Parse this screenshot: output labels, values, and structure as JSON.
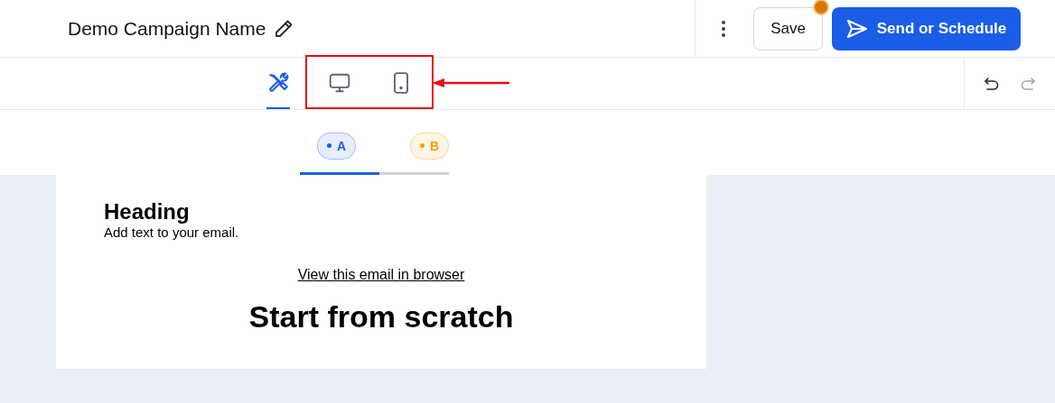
{
  "header": {
    "campaign_name": "Demo Campaign Name",
    "save": {
      "label": "Save",
      "unsaved": true
    },
    "send": {
      "label": "Send or Schedule"
    }
  },
  "toolbar": {
    "views": [
      {
        "kind": "tools",
        "selected": true
      },
      {
        "kind": "desktop",
        "selected": false
      },
      {
        "kind": "mobile",
        "selected": false
      }
    ],
    "undo": {
      "disabled": false
    },
    "redo": {
      "disabled": true
    }
  },
  "variants": [
    {
      "label": "A",
      "selected": true,
      "color": "#1a5ee8"
    },
    {
      "label": "B",
      "selected": false,
      "color": "#f0a000"
    }
  ],
  "email": {
    "heading": "Heading",
    "text": "Add text to your email.",
    "browser_link": "View this email in browser",
    "title": "Start from scratch"
  }
}
